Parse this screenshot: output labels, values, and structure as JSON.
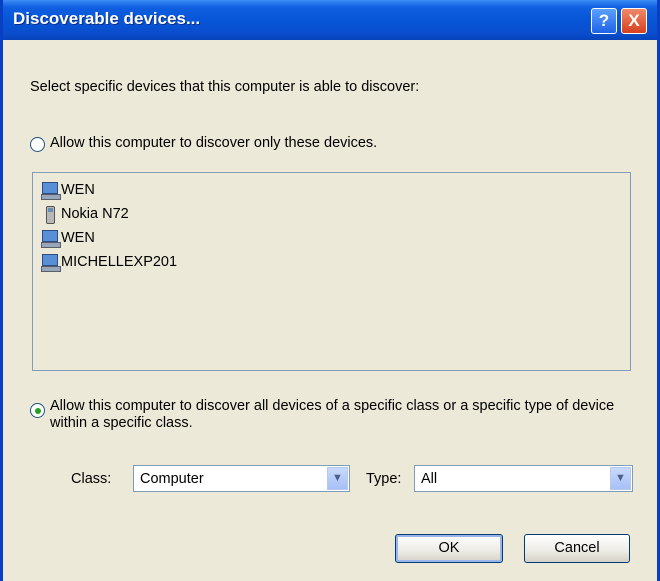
{
  "window": {
    "title": "Discoverable devices...",
    "help_icon_text": "?",
    "close_icon_text": "X"
  },
  "intro_text": "Select specific devices that this computer is able to discover:",
  "option_only": {
    "label": "Allow this computer to discover only these devices.",
    "selected": false
  },
  "devices": [
    {
      "name": "WEN",
      "icon": "computer-icon"
    },
    {
      "name": "Nokia N72",
      "icon": "phone-icon"
    },
    {
      "name": "WEN",
      "icon": "computer-icon"
    },
    {
      "name": "MICHELLEXP201",
      "icon": "laptop-icon"
    }
  ],
  "option_class": {
    "label": "Allow this computer to discover all devices of a specific class or a specific type of device within a specific class.",
    "selected": true
  },
  "class_label": "Class:",
  "class_value": "Computer",
  "type_label": "Type:",
  "type_value": "All",
  "ok_label": "OK",
  "cancel_label": "Cancel"
}
